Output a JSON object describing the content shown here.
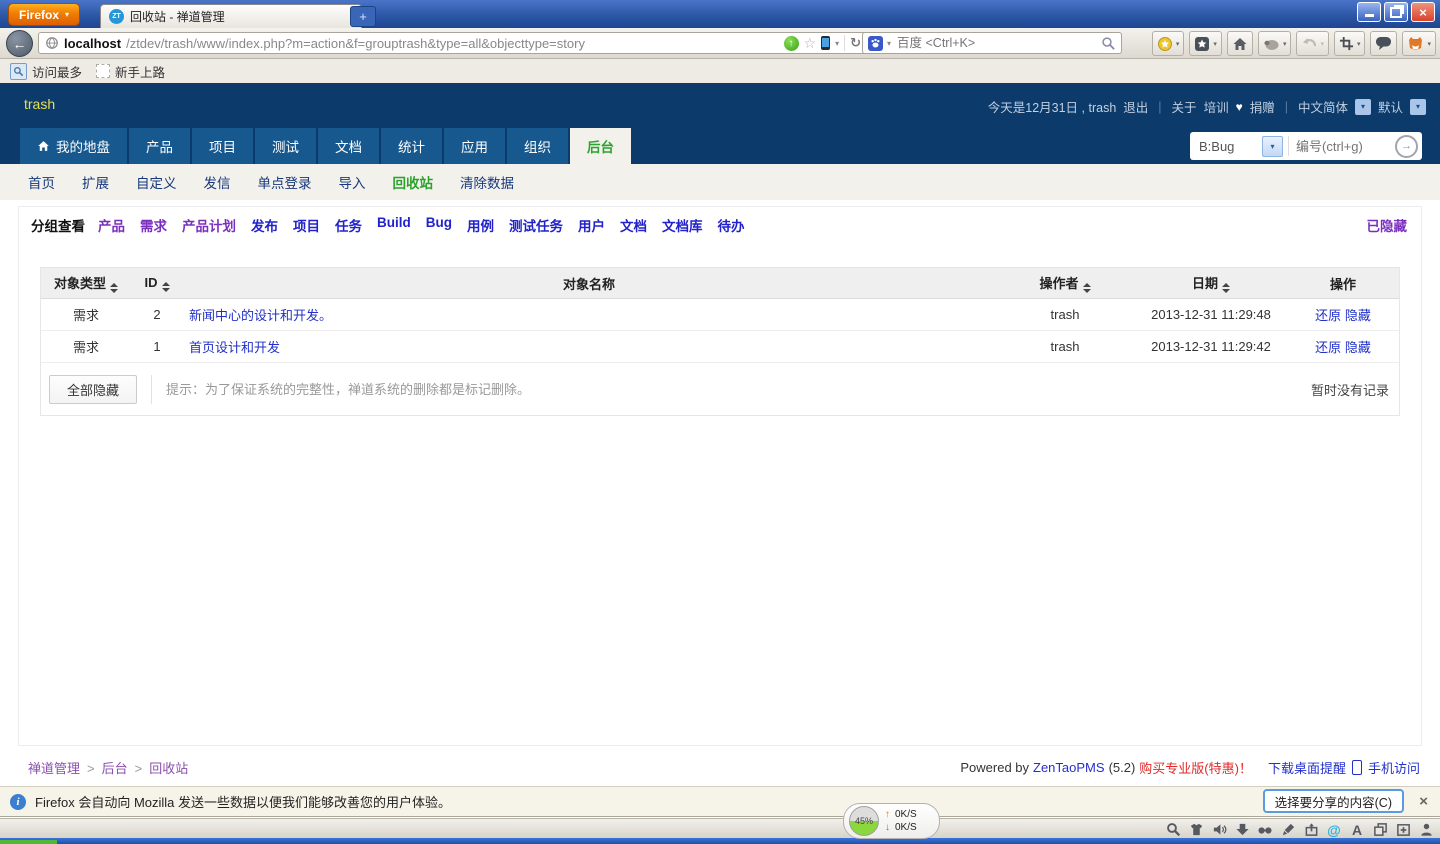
{
  "icons": {
    "dropdown": "▾",
    "heart": "♥",
    "back": "←",
    "up": "↑",
    "down": "↓",
    "close": "×",
    "at": "@",
    "letter_a": "A",
    "go": "→",
    "star": "☆",
    "reload": "↻",
    "info": "i"
  },
  "chrome": {
    "app_button": "Firefox",
    "tab_title": "回收站 - 禅道管理",
    "favicon_text": "ZT",
    "new_tab": "+",
    "url_host": "localhost",
    "url_path": "/ztdev/trash/www/index.php?m=action&f=grouptrash&type=all&objecttype=story",
    "search_placeholder": "百度 <Ctrl+K>",
    "bookmarks": [
      {
        "label": "访问最多"
      },
      {
        "label": "新手上路"
      }
    ]
  },
  "header": {
    "brand": "trash",
    "date_text": "今天是12月31日 , trash",
    "logout": "退出",
    "sep": "|",
    "about": "关于",
    "training": "培训",
    "donate": "捐赠",
    "language": "中文简体",
    "theme": "默认"
  },
  "nav": {
    "tabs": [
      {
        "label": "我的地盘"
      },
      {
        "label": "产品"
      },
      {
        "label": "项目"
      },
      {
        "label": "测试"
      },
      {
        "label": "文档"
      },
      {
        "label": "统计"
      },
      {
        "label": "应用"
      },
      {
        "label": "组织"
      },
      {
        "label": "后台"
      }
    ],
    "search_type": "B:Bug",
    "search_placeholder": "编号(ctrl+g)"
  },
  "subnav": {
    "items": [
      {
        "label": "首页"
      },
      {
        "label": "扩展"
      },
      {
        "label": "自定义"
      },
      {
        "label": "发信"
      },
      {
        "label": "单点登录"
      },
      {
        "label": "导入"
      },
      {
        "label": "回收站"
      },
      {
        "label": "清除数据"
      }
    ]
  },
  "toolbar": {
    "view_label": "分组查看",
    "links": [
      {
        "label": "产品",
        "visited": true
      },
      {
        "label": "需求",
        "visited": true
      },
      {
        "label": "产品计划",
        "visited": true
      },
      {
        "label": "发布",
        "visited": false
      },
      {
        "label": "项目",
        "visited": false
      },
      {
        "label": "任务",
        "visited": false
      },
      {
        "label": "Build",
        "visited": false
      },
      {
        "label": "Bug",
        "visited": false
      },
      {
        "label": "用例",
        "visited": false
      },
      {
        "label": "测试任务",
        "visited": false
      },
      {
        "label": "用户",
        "visited": false
      },
      {
        "label": "文档",
        "visited": false
      },
      {
        "label": "文档库",
        "visited": false
      },
      {
        "label": "待办",
        "visited": false
      }
    ],
    "hidden_link": "已隐藏"
  },
  "table": {
    "headers": {
      "type": "对象类型",
      "id": "ID",
      "name": "对象名称",
      "actor": "操作者",
      "date": "日期",
      "action": "操作"
    },
    "rows": [
      {
        "type": "需求",
        "id": "2",
        "name": "新闻中心的设计和开发。",
        "actor": "trash",
        "date": "2013-12-31 11:29:48",
        "restore": "还原",
        "hide": "隐藏"
      },
      {
        "type": "需求",
        "id": "1",
        "name": "首页设计和开发",
        "actor": "trash",
        "date": "2013-12-31 11:29:42",
        "restore": "还原",
        "hide": "隐藏"
      }
    ],
    "hide_all_button": "全部隐藏",
    "hint": "提示：为了保证系统的完整性，禅道系统的删除都是标记删除。",
    "no_record": "暂时没有记录"
  },
  "footer": {
    "breadcrumb": [
      {
        "label": "禅道管理"
      },
      {
        "label": "后台"
      },
      {
        "label": "回收站"
      }
    ],
    "sep": ">",
    "powered_by": "Powered by",
    "product": "ZenTaoPMS",
    "version": "(5.2)",
    "buy_link": "购买专业版(特惠)！",
    "download_link": "下载桌面提醒",
    "mobile_link": "手机访问"
  },
  "notification": {
    "message": "Firefox 会自动向 Mozilla 发送一些数据以便我们能够改善您的用户体验。",
    "share_button": "选择要分享的内容(C)",
    "close": "×"
  },
  "statusbar": {
    "progress": "45%",
    "upload_speed": "0K/S",
    "download_speed": "0K/S"
  }
}
